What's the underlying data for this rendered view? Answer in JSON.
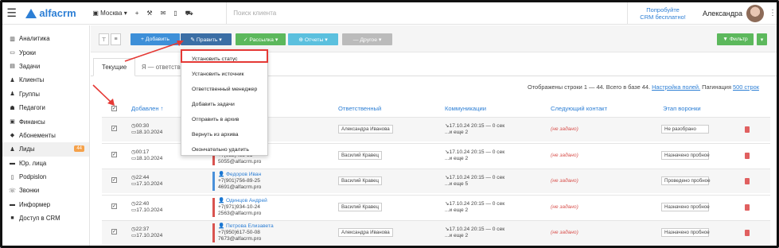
{
  "topbar": {
    "brand": "alfacrm",
    "city": "Москва",
    "search_placeholder": "Поиск клиента",
    "promo_line1": "Попробуйте",
    "promo_line2": "CRM бесплатно!",
    "user_name": "Александра"
  },
  "sidebar": {
    "items": [
      {
        "label": "Аналитика",
        "icon": "chart-icon"
      },
      {
        "label": "Уроки",
        "icon": "lessons-icon"
      },
      {
        "label": "Задачи",
        "icon": "tasks-icon"
      },
      {
        "label": "Клиенты",
        "icon": "user-icon"
      },
      {
        "label": "Группы",
        "icon": "group-icon"
      },
      {
        "label": "Педагоги",
        "icon": "teacher-icon"
      },
      {
        "label": "Финансы",
        "icon": "finance-icon"
      },
      {
        "label": "Абонементы",
        "icon": "tag-icon"
      },
      {
        "label": "Лиды",
        "icon": "leads-icon",
        "badge": "44"
      },
      {
        "label": "Юр. лица",
        "icon": "company-icon"
      },
      {
        "label": "Podpislon",
        "icon": "sign-icon"
      },
      {
        "label": "Звонки",
        "icon": "phone-icon"
      },
      {
        "label": "Информер",
        "icon": "informer-icon"
      },
      {
        "label": "Доступ в CRM",
        "icon": "lock-icon"
      }
    ]
  },
  "toolbar": {
    "add": "+ Добавить",
    "edit": "✎ Править ▾",
    "mailing": "✓ Рассылка ▾",
    "reports": "⊕ Отчеты ▾",
    "other": "— Другое ▾",
    "filter": "▼ Фильтр"
  },
  "tabs": {
    "current": "Текущие",
    "mine": "Я — ответстве..."
  },
  "dropdown": {
    "items": [
      "Установить статус",
      "Установить источник",
      "Ответственный менеджер",
      "Добавить задачи",
      "Отправить в архив",
      "Вернуть из архива",
      "Окончательно удалить"
    ]
  },
  "pager": {
    "summary": "Отображены строки 1 — 44. Всего в базе 44.",
    "settings_link": "Настройка полей.",
    "pagination_label": "Пагинация",
    "pagination_link": "500 строк"
  },
  "table": {
    "headers": {
      "added": "Добавлен ↑",
      "responsible": "Ответственный",
      "communications": "Коммуникации",
      "next_contact": "Следующий контакт",
      "stage": "Этап воронки"
    },
    "rows": [
      {
        "time": "◷00:30",
        "date": "▭18.10.2024",
        "contact": [
          "",
          "",
          ""
        ],
        "contact_color": "red",
        "responsible": "Александра Иванова",
        "comm1": "↘17.10.24 20:15 — 0 сек",
        "comm2": "...и еще 2",
        "next": "(не задано)",
        "stage": "Не разобрано"
      },
      {
        "time": "◷00:17",
        "date": "▭18.10.2024",
        "contact": [
          "я",
          "+7(952)485-31",
          "5055@alfacrm.pro"
        ],
        "contact_color": "red",
        "responsible": "Василий Кравец",
        "comm1": "↘17.10.24 20:15 — 0 сек",
        "comm2": "...и еще 2",
        "next": "(не задано)",
        "stage": "Назначено пробное"
      },
      {
        "time": "◷22:44",
        "date": "▭17.10.2024",
        "contact": [
          "👤 Федоров Иван",
          "+7(901)756-89-25",
          "4691@alfacrm.pro"
        ],
        "contact_color": "blue",
        "responsible": "Василий Кравец",
        "comm1": "↘17.10.24 20:15 — 0 сек",
        "comm2": "...и еще 5",
        "next": "(не задано)",
        "stage": "Проведено пробное"
      },
      {
        "time": "◷22:40",
        "date": "▭17.10.2024",
        "contact": [
          "👤 Одинцов Андрей",
          "+7(971)934-10-24",
          "2563@alfacrm.pro"
        ],
        "contact_color": "red",
        "responsible": "Василий Кравец",
        "comm1": "↘17.10.24 20:15 — 0 сек",
        "comm2": "...и еще 2",
        "next": "(не задано)",
        "stage": "Назначено пробное"
      },
      {
        "time": "◷22:37",
        "date": "▭17.10.2024",
        "contact": [
          "👤 Петрова Елизавета",
          "+7(950)617-50-08",
          "7673@alfacrm.pro"
        ],
        "contact_color": "red",
        "responsible": "Александра Иванова",
        "comm1": "↘17.10.24 20:15 — 0 сек",
        "comm2": "...и еще 2",
        "next": "(не задано)",
        "stage": "Назначено пробное"
      }
    ]
  },
  "colors": {
    "primary": "#2d7fd5",
    "add_button": "#3d8fd8",
    "edit_button": "#3b6ea5",
    "mailing_button": "#5cb85c",
    "reports_button": "#5bc0de",
    "other_button": "#bbbbbb",
    "filter_button": "#5cb85c",
    "highlight": "#e53935",
    "badge": "#f5a14a"
  }
}
